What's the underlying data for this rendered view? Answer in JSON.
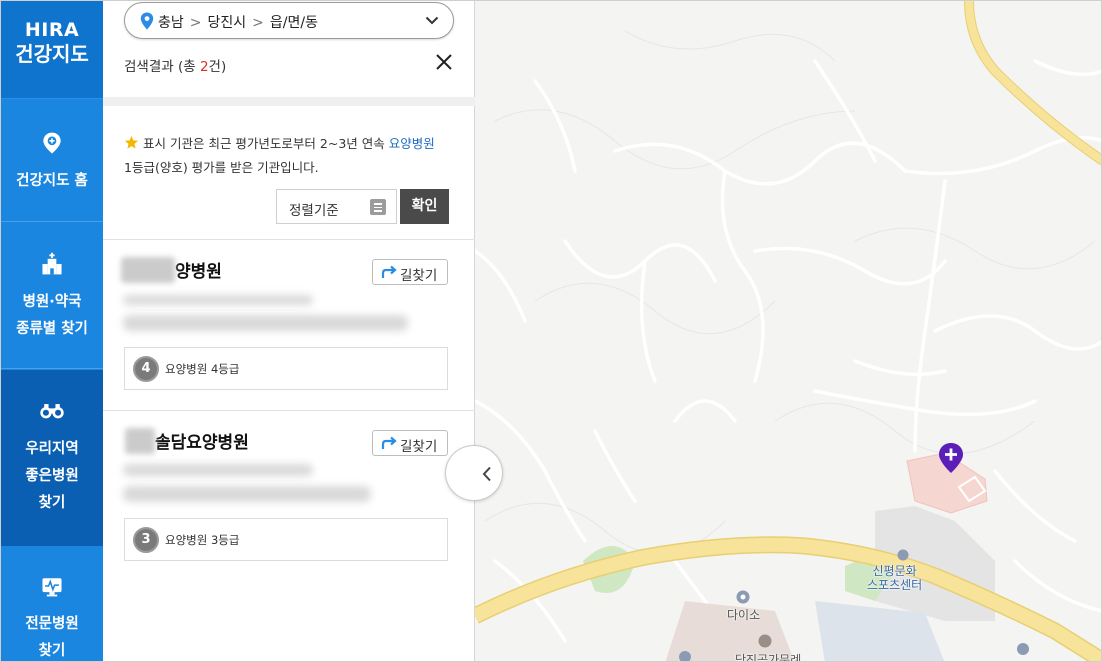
{
  "nav": {
    "logo_line1": "HIRA",
    "logo_line2": "건강지도",
    "items": [
      {
        "label": "건강지도 홈",
        "icon": "map-pin-icon"
      },
      {
        "label_line1": "병원·약국",
        "label_line2": "종류별 찾기",
        "icon": "hospital-building-icon"
      },
      {
        "label_line1": "우리지역",
        "label_line2": "좋은병원",
        "label_line3": "찾기",
        "icon": "binoculars-icon"
      },
      {
        "label_line1": "전문병원",
        "label_line2": "찾기",
        "icon": "specialty-monitor-icon"
      }
    ]
  },
  "location": {
    "region": "충남",
    "city": "당진시",
    "district": "읍/면/동"
  },
  "results": {
    "prefix": "검색결과 (총 ",
    "count": "2",
    "suffix": "건)"
  },
  "notice": {
    "text_before": "표시 기관은 최근 평가년도로부터 2~3년 연속 ",
    "highlight": "요양병원",
    "line2": "1등급(양호) 평가를 받은 기관입니다."
  },
  "sort": {
    "label": "정렬기준",
    "confirm": "확인"
  },
  "hospitals": [
    {
      "name_visible": "양병원",
      "route_label": "길찾기",
      "grade_number": "4",
      "grade_text": "요양병원 4등급"
    },
    {
      "name_visible": "솔담요양병원",
      "route_label": "길찾기",
      "grade_number": "3",
      "grade_text": "요양병원 3등급"
    }
  ],
  "map": {
    "labels": {
      "sports_line1": "신평문화",
      "sports_line2": "스포츠센터",
      "store": "다이소",
      "bottom": "당진공가문례"
    },
    "colors": {
      "road": "#f7e39a",
      "road_edge": "#e8cf73",
      "marker": "#5b1fb8"
    }
  }
}
